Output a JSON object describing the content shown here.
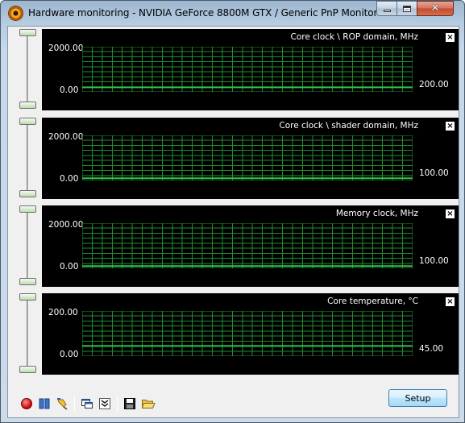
{
  "window": {
    "title": "Hardware monitoring - NVIDIA GeForce 8800M GTX / Generic PnP Monitor",
    "close_glyph": "✕",
    "minimize_icon": "minimize-icon",
    "maximize_icon": "maximize-icon",
    "close_icon": "close-icon"
  },
  "graphs": [
    {
      "title": "Core clock \\ ROP domain, MHz",
      "max": "2000.00",
      "min": "0.00",
      "current": "200.00",
      "level": 0.1
    },
    {
      "title": "Core clock \\ shader domain, MHz",
      "max": "2000.00",
      "min": "0.00",
      "current": "100.00",
      "level": 0.05
    },
    {
      "title": "Memory clock, MHz",
      "max": "2000.00",
      "min": "0.00",
      "current": "100.00",
      "level": 0.05
    },
    {
      "title": "Core temperature, °C",
      "max": "200.00",
      "min": "0.00",
      "current": "45.00",
      "level": 0.225
    }
  ],
  "graph_close_label": "×",
  "toolbar": {
    "icons": [
      "record-icon",
      "pause-icon",
      "pin-icon",
      "window-icon",
      "collapse-icon",
      "save-icon",
      "open-folder-icon"
    ],
    "setup_label": "Setup"
  },
  "colors": {
    "grid": "#1f8f2f",
    "graph_bg": "#000000",
    "line": "#35c24a",
    "record": "#d41a1a",
    "pause": "#2a5fb8"
  }
}
